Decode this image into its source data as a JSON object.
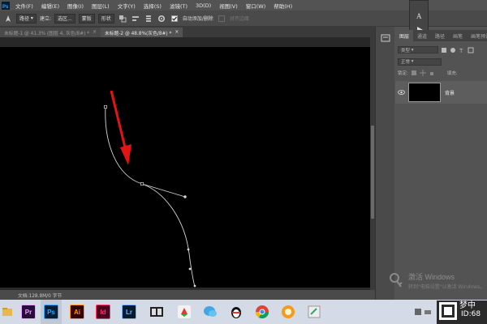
{
  "menu": {
    "items": [
      "文件(F)",
      "编辑(E)",
      "图像(I)",
      "图层(L)",
      "文字(Y)",
      "选择(S)",
      "滤镜(T)",
      "3D(D)",
      "视图(V)",
      "窗口(W)",
      "帮助(H)"
    ]
  },
  "options_bar": {
    "tool_mode": "路径",
    "make_label": "建立:",
    "selection_btn": "选区...",
    "mask_btn": "蒙版",
    "shape_btn": "形状",
    "auto_add_delete": "自动添加/删除",
    "align_edges": "对齐边缘"
  },
  "tabs": [
    {
      "label": "未标题-1 @ 41.3% (图层 4, 灰色/8#) *",
      "active": false
    },
    {
      "label": "未标题-2 @ 48.8%(灰色/8#) *",
      "active": true
    }
  ],
  "status_bar": {
    "doc_info": "文档:128.8M/0 字节"
  },
  "layers_panel": {
    "tabs": [
      "图层",
      "通道",
      "路径",
      "画笔",
      "画笔预设"
    ],
    "kind_label": "类型",
    "blend_mode": "正常",
    "lock_label": "锁定:",
    "fill_label": "填充:",
    "layer_name": "背景"
  },
  "windows_watermark": {
    "title": "激活 Windows",
    "subtitle": "转到\"电脑设置\"以激活 Windows。"
  },
  "taskbar": {
    "apps": [
      {
        "label": "Pr",
        "bg": "#2a0a3a",
        "fg": "#e6a3ff"
      },
      {
        "label": "Ps",
        "bg": "#001e36",
        "fg": "#31a8ff"
      },
      {
        "label": "Ai",
        "bg": "#330000",
        "fg": "#ff9a00"
      },
      {
        "label": "Id",
        "bg": "#49021f",
        "fg": "#ff3366"
      },
      {
        "label": "Lr",
        "bg": "#001a2e",
        "fg": "#74b4ff"
      }
    ],
    "brand": "梦中",
    "brand_id": "ID:68"
  },
  "colors": {
    "arrow": "#e31414",
    "path": "#d8d8d8",
    "canvas": "#000000"
  }
}
